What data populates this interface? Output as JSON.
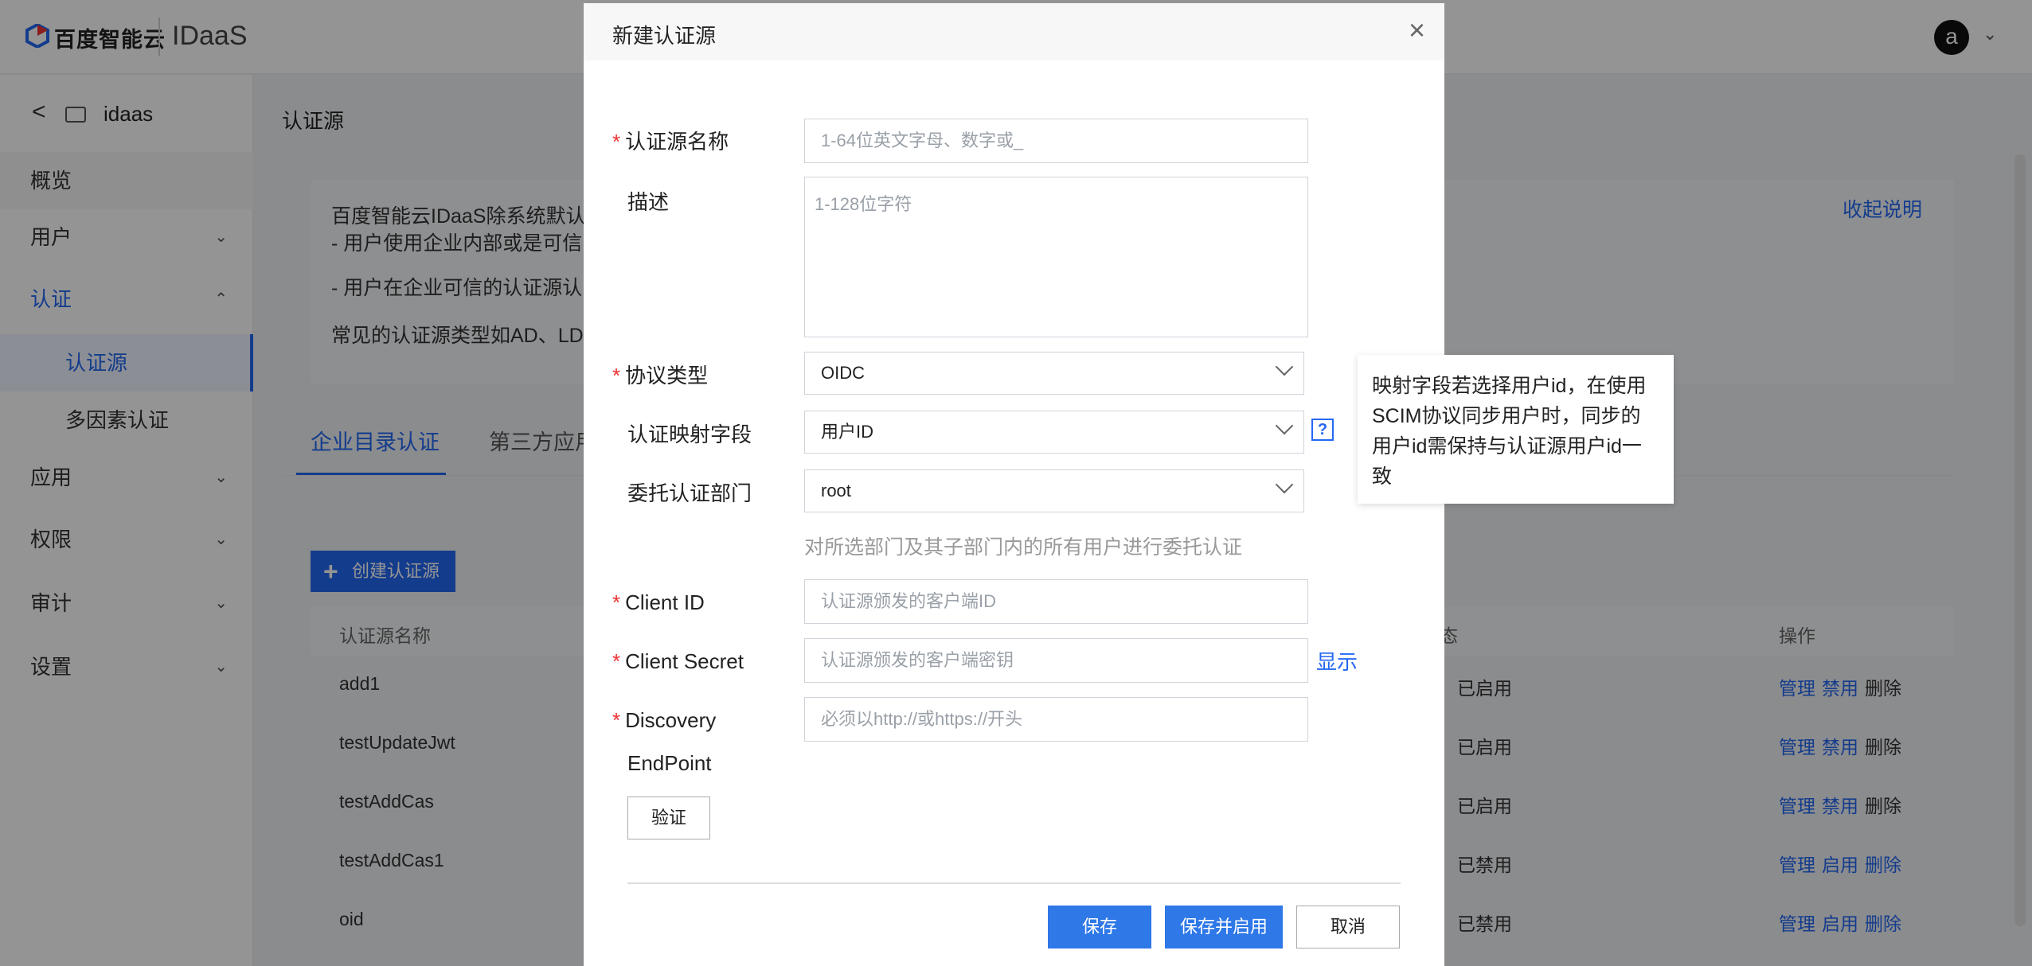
{
  "header": {
    "brand": "百度智能云",
    "product": "IDaaS",
    "avatar_letter": "a"
  },
  "sidebar": {
    "back_icon": "chevron-left-icon",
    "app_name": "idaas",
    "items": [
      {
        "label": "概览"
      },
      {
        "label": "用户"
      },
      {
        "label": "认证"
      },
      {
        "label": "认证源"
      },
      {
        "label": "多因素认证"
      },
      {
        "label": "应用"
      },
      {
        "label": "权限"
      },
      {
        "label": "审计"
      },
      {
        "label": "设置"
      }
    ]
  },
  "main": {
    "title": "认证源",
    "description": {
      "line1": "百度智能云IDaaS除系统默认",
      "line2": "- 用户使用企业内部或是可信",
      "line3": "- 用户在企业可信的认证源认",
      "line4": "常见的认证源类型如AD、LD",
      "collapse": "收起说明"
    },
    "tabs": [
      {
        "label": "企业目录认证"
      },
      {
        "label": "第三方应用"
      }
    ],
    "create_button": "创建认证源",
    "table": {
      "col_name": "认证源名称",
      "col_status": "态",
      "col_ops": "操作",
      "rows": [
        {
          "name": "add1",
          "status": "已启用",
          "op1": "管理",
          "op2": "禁用",
          "op3": "删除"
        },
        {
          "name": "testUpdateJwt",
          "status": "已启用",
          "op1": "管理",
          "op2": "禁用",
          "op3": "删除"
        },
        {
          "name": "testAddCas",
          "status": "已启用",
          "op1": "管理",
          "op2": "禁用",
          "op3": "删除"
        },
        {
          "name": "testAddCas1",
          "status": "已禁用",
          "op1": "管理",
          "op2": "启用",
          "op3": "删除"
        },
        {
          "name": "oid",
          "status": "已禁用",
          "op1": "管理",
          "op2": "启用",
          "op3": "删除"
        }
      ]
    }
  },
  "modal": {
    "title": "新建认证源",
    "close": "×",
    "fields": {
      "name": {
        "label": "认证源名称",
        "placeholder": "1-64位英文字母、数字或_"
      },
      "desc": {
        "label": "描述",
        "placeholder": "1-128位字符"
      },
      "protocol": {
        "label": "协议类型",
        "value": "OIDC"
      },
      "mapping": {
        "label": "认证映射字段",
        "value": "用户ID",
        "help": "?"
      },
      "department": {
        "label": "委托认证部门",
        "value": "root",
        "hint": "对所选部门及其子部门内的所有用户进行委托认证"
      },
      "client_id": {
        "label": "Client ID",
        "placeholder": "认证源颁发的客户端ID"
      },
      "client_secret": {
        "label": "Client Secret",
        "placeholder": "认证源颁发的客户端密钥",
        "show": "显示"
      },
      "discovery": {
        "label_line1": "Discovery",
        "label_line2": "EndPoint",
        "placeholder": "必须以http://或https://开头"
      }
    },
    "verify_button": "验证",
    "save_button": "保存",
    "save_enable_button": "保存并启用",
    "cancel_button": "取消"
  },
  "tooltip": {
    "text": "映射字段若选择用户id，在使用SCIM协议同步用户时，同步的用户id需保持与认证源用户id一致"
  },
  "colors": {
    "primary": "#2468f2",
    "required": "#e33333"
  }
}
